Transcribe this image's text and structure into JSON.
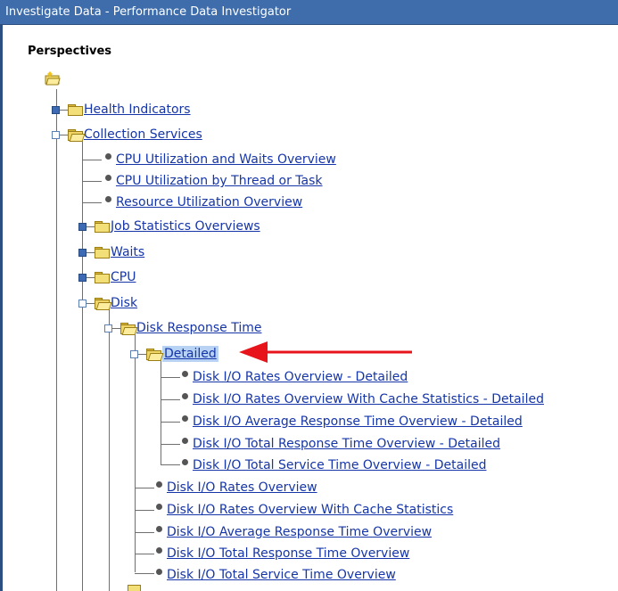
{
  "window": {
    "title": "Investigate Data - Performance Data Investigator"
  },
  "panel": {
    "heading": "Perspectives"
  },
  "colors": {
    "link": "#1535a8",
    "titlebar": "#3f6dab",
    "selection": "#b7d2f3",
    "arrow": "#e8141b"
  },
  "tree": {
    "health_indicators": "Health Indicators",
    "collection_services": "Collection Services",
    "cpu_utilization_waits": "CPU Utilization and Waits Overview",
    "cpu_utilization_thread": "CPU Utilization by Thread or Task",
    "resource_utilization": "Resource Utilization Overview",
    "job_statistics": "Job Statistics Overviews",
    "waits": "Waits",
    "cpu": "CPU",
    "disk": "Disk",
    "disk_response_time": "Disk Response Time",
    "detailed": "Detailed",
    "detailed_items": [
      "Disk I/O Rates Overview - Detailed",
      "Disk I/O Rates Overview With Cache Statistics - Detailed",
      "Disk I/O Average Response Time Overview - Detailed",
      "Disk I/O Total Response Time Overview - Detailed",
      "Disk I/O Total Service Time Overview - Detailed"
    ],
    "response_items": [
      "Disk I/O Rates Overview",
      "Disk I/O Rates Overview With Cache Statistics",
      "Disk I/O Average Response Time Overview",
      "Disk I/O Total Response Time Overview",
      "Disk I/O Total Service Time Overview"
    ]
  }
}
